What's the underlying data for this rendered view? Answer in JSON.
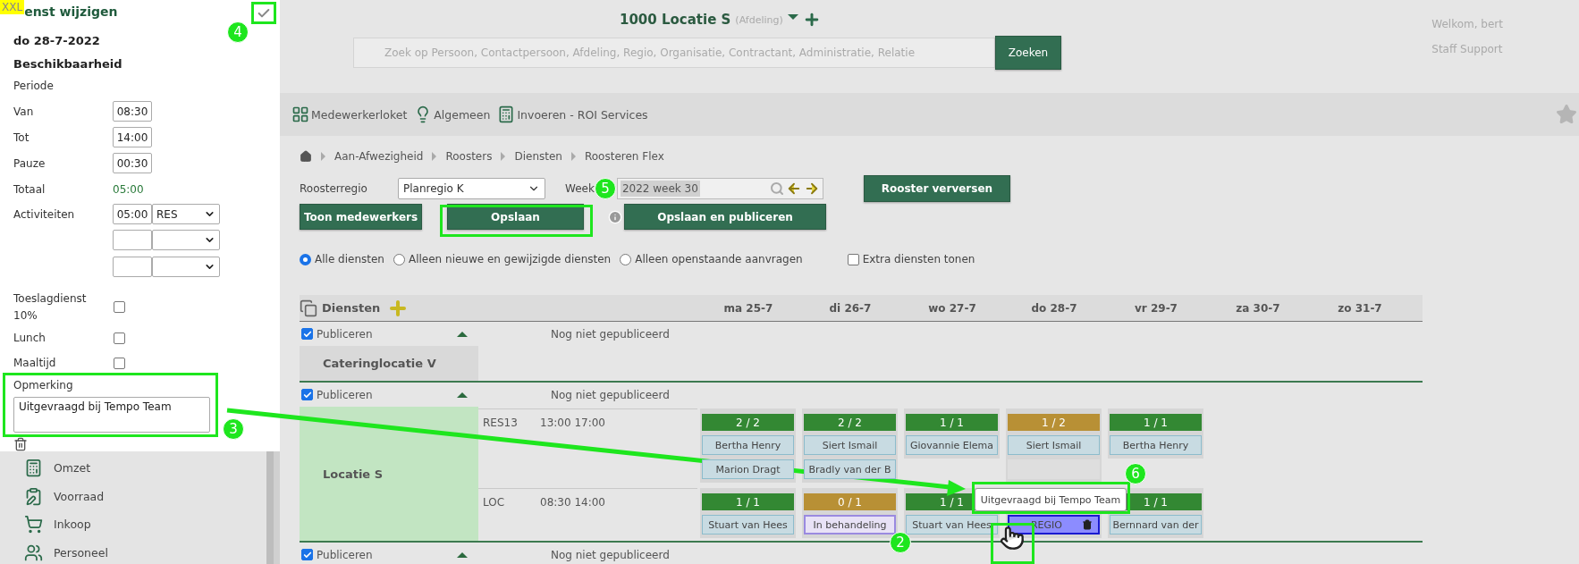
{
  "edit_panel": {
    "badge": "XXL",
    "title": "enst wijzigen",
    "date": "do 28-7-2022",
    "section": "Beschikbaarheid",
    "period_label": "Periode",
    "times": [
      {
        "label": "Van",
        "value": "08:30"
      },
      {
        "label": "Tot",
        "value": "14:00"
      },
      {
        "label": "Pauze",
        "value": "00:30"
      }
    ],
    "total": {
      "label": "Totaal",
      "value": "05:00"
    },
    "activities": {
      "label": "Activiteiten",
      "rows": [
        {
          "kind": "filled",
          "hours": "05:00",
          "code": "RES"
        },
        {
          "kind": "empty"
        },
        {
          "kind": "empty"
        }
      ]
    },
    "options": [
      {
        "label": "Toeslagdienst 10%",
        "checked": false
      },
      {
        "label": "Lunch",
        "checked": false
      },
      {
        "label": "Maaltijd",
        "checked": false
      }
    ],
    "remark": {
      "label": "Opmerking",
      "value": "Uitgevraagd bij Tempo Team"
    }
  },
  "sidebar": {
    "items": [
      {
        "label": "Omzet"
      },
      {
        "label": "Voorraad"
      },
      {
        "label": "Inkoop"
      },
      {
        "label": "Personeel"
      }
    ]
  },
  "header": {
    "title": "1000 Locatie S",
    "subtitle": "(Afdeling)",
    "search": {
      "placeholder": "Zoek op Persoon, Contactpersoon, Afdeling, Regio, Organisatie, Contractant, Administratie, Relatie"
    },
    "search_button": "Zoeken",
    "welcome": "Welkom, bert",
    "account": "Staff Support"
  },
  "toolbar": {
    "items": [
      {
        "label": "Medewerkerloket"
      },
      {
        "label": "Algemeen"
      },
      {
        "label": "Invoeren - ROI Services"
      }
    ]
  },
  "breadcrumb": [
    "Aan-Afwezigheid",
    "Roosters",
    "Diensten",
    "Roosteren Flex"
  ],
  "filters": {
    "region_label": "Roosterregio",
    "region_value": "Planregio K",
    "week_label": "Week",
    "week_value": "2022 week 30",
    "refresh_button": "Rooster verversen"
  },
  "actions": [
    "Toon medewerkers",
    "Opslaan",
    "Opslaan en publiceren"
  ],
  "radios": [
    {
      "label": "Alle diensten",
      "selected": true
    },
    {
      "label": "Alleen nieuwe en gewijzigde diensten",
      "selected": false
    },
    {
      "label": "Alleen openstaande aanvragen",
      "selected": false
    }
  ],
  "extra": {
    "label": "Extra diensten tonen",
    "checked": false
  },
  "schedule": {
    "title": "Diensten",
    "days": [
      "ma 25-7",
      "di 26-7",
      "wo 27-7",
      "do 28-7",
      "vr 29-7",
      "za 30-7",
      "zo 31-7"
    ],
    "groups": [
      {
        "publish_label": "Publiceren",
        "checked": true,
        "status": "Nog niet gepubliceerd",
        "name": "Cateringlocatie V",
        "highlighted": false
      },
      {
        "publish_label": "Publiceren",
        "checked": true,
        "status": "Nog niet gepubliceerd",
        "name": "Locatie S",
        "highlighted": true,
        "shifts": [
          {
            "code": "RES13",
            "time": "13:00 17:00",
            "days": [
              {
                "count": "2 / 2",
                "color": "#338833",
                "entries": [
                  {
                    "kind": "person",
                    "label": "Bertha Henry"
                  },
                  {
                    "kind": "person",
                    "label": "Marion Dragt"
                  }
                ]
              },
              {
                "count": "2 / 2",
                "color": "#338833",
                "entries": [
                  {
                    "kind": "person",
                    "label": "Siert Ismail"
                  },
                  {
                    "kind": "person",
                    "label": "Bradly van der B"
                  }
                ]
              },
              {
                "count": "1 / 1",
                "color": "#338833",
                "entries": [
                  {
                    "kind": "person",
                    "label": "Giovannie Elema"
                  }
                ]
              },
              {
                "count": "1 / 2",
                "color": "#b89035",
                "entries": [
                  {
                    "kind": "person",
                    "label": "Siert Ismail"
                  },
                  {
                    "kind": "empty"
                  }
                ]
              },
              {
                "count": "1 / 1",
                "color": "#338833",
                "entries": [
                  {
                    "kind": "person",
                    "label": "Bertha Henry"
                  }
                ]
              }
            ]
          },
          {
            "code": "LOC",
            "time": "08:30 14:00",
            "days": [
              {
                "count": "1 / 1",
                "color": "#338833",
                "entries": [
                  {
                    "kind": "person",
                    "label": "Stuart van Hees"
                  }
                ]
              },
              {
                "count": "0 / 1",
                "color": "#b89035",
                "entries": [
                  {
                    "kind": "pending",
                    "label": "In behandeling"
                  }
                ]
              },
              {
                "count": "1 / 1",
                "color": "#338833",
                "entries": [
                  {
                    "kind": "person",
                    "label": "Stuart van Hees"
                  }
                ]
              },
              {
                "kind": "regio",
                "entries": [
                  {
                    "kind": "regio",
                    "label": "REGIO"
                  }
                ]
              },
              {
                "count": "1 / 1",
                "color": "#338833",
                "entries": [
                  {
                    "kind": "person",
                    "label": "Bernnard van der"
                  }
                ]
              }
            ]
          }
        ]
      },
      {
        "publish_label": "Publiceren",
        "checked": true,
        "status": "Nog niet gepubliceerd"
      }
    ]
  },
  "tooltip": "Uitgevraagd bij Tempo Team",
  "markers": [
    "4",
    "3",
    "5",
    "2",
    "6"
  ]
}
